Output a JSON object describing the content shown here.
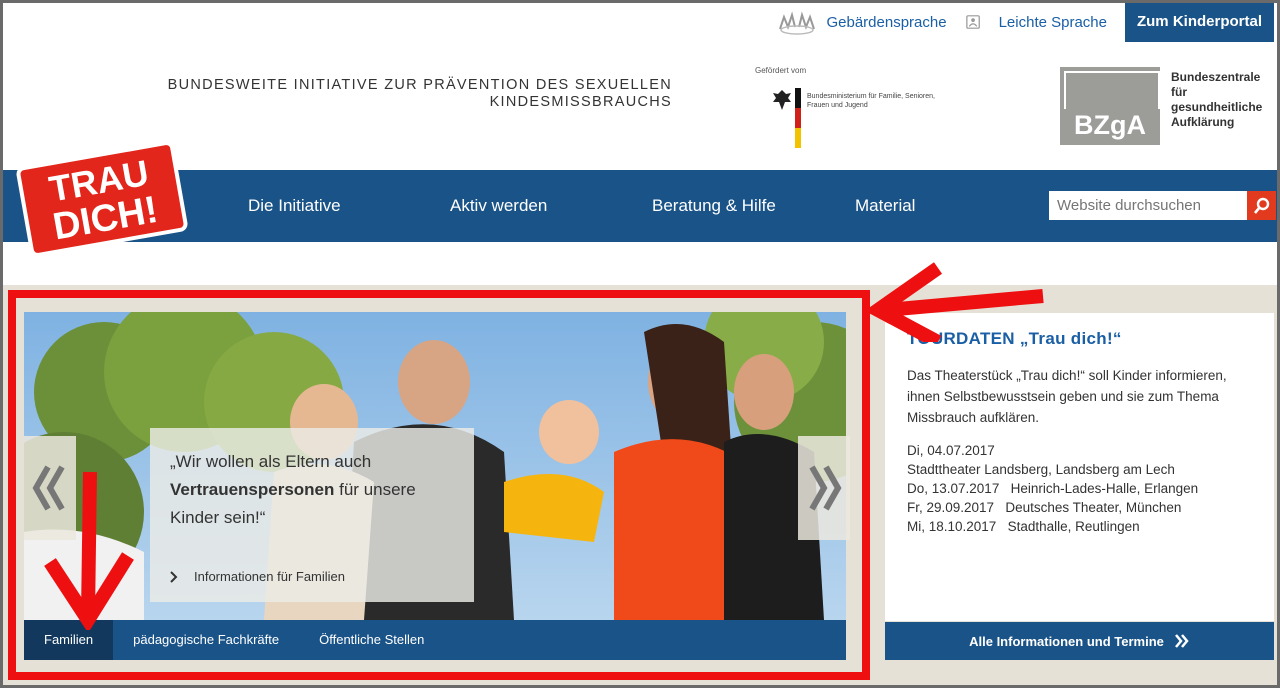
{
  "utility": {
    "sign_language": "Gebärdensprache",
    "easy_language": "Leichte Sprache",
    "kids_portal": "Zum Kinderportal"
  },
  "header": {
    "initiative": "Bundesweite Initiative zur Prävention des sexuellen Kindesmissbrauchs",
    "sponsor_label": "Gefördert vom",
    "ministry": "Bundesministerium für Familie, Senioren, Frauen und Jugend",
    "bzga_logo": "BZgA",
    "bzga_name": "Bundeszentrale für gesundheitliche Aufklärung"
  },
  "logo": {
    "line1": "TRAU",
    "line2": "DICH!"
  },
  "nav": {
    "items": [
      "Die Initiative",
      "Aktiv werden",
      "Beratung & Hilfe",
      "Material"
    ],
    "search_placeholder": "Website durchsuchen"
  },
  "slider": {
    "quote_prefix": "„Wir wollen als Eltern auch",
    "quote_bold": "Vertrauenspersonen",
    "quote_suffix": " für unsere Kinder sein!“",
    "link": "Informationen für Familien",
    "tabs": [
      "Familien",
      "pädagogische Fachkräfte",
      "Öffentliche Stellen"
    ]
  },
  "tour": {
    "title": "TOURDATEN „Trau dich!“",
    "description": "Das Theaterstück „Trau dich!“ soll Kinder informieren, ihnen Selbstbewusstsein geben und sie zum Thema Missbrauch aufklären.",
    "dates": [
      "Di, 04.07.2017",
      "Stadttheater Landsberg, Landsberg am Lech",
      "Do, 13.07.2017   Heinrich-Lades-Halle, Erlangen",
      "Fr, 29.09.2017   Deutsches Theater, München",
      "Mi, 18.10.2017   Stadthalle, Reutlingen"
    ],
    "cta": "Alle Informationen und Termine"
  },
  "colors": {
    "brand_blue": "#1a5387",
    "link_blue": "#1a5fa6",
    "annotation_red": "#ee1010",
    "search_red": "#e13a1f"
  }
}
